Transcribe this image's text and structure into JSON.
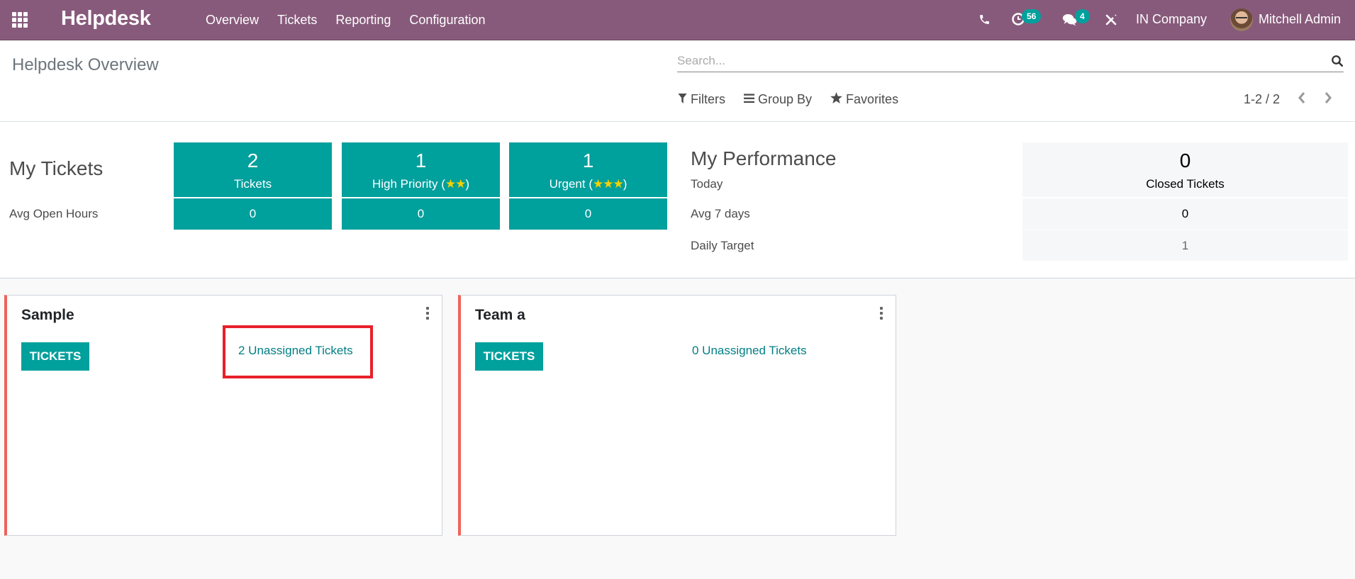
{
  "navbar": {
    "app_name": "Helpdesk",
    "menu": [
      "Overview",
      "Tickets",
      "Reporting",
      "Configuration"
    ],
    "activity_count": "56",
    "message_count": "4",
    "company": "IN Company",
    "user": "Mitchell Admin",
    "colors": {
      "brand": "#875a7b",
      "badge": "#00a09d"
    }
  },
  "control_panel": {
    "title": "Helpdesk Overview",
    "search_placeholder": "Search...",
    "filters_label": "Filters",
    "group_by_label": "Group By",
    "favorites_label": "Favorites",
    "pager": "1-2 / 2"
  },
  "dashboard": {
    "my_tickets": {
      "heading": "My Tickets",
      "avg_label": "Avg Open Hours",
      "tiles": [
        {
          "count": "2",
          "label": "Tickets",
          "stars": "",
          "avg": "0"
        },
        {
          "count": "1",
          "label": "High Priority (",
          "stars": "★★",
          "suffix": ")",
          "avg": "0"
        },
        {
          "count": "1",
          "label": "Urgent (",
          "stars": "★★★",
          "suffix": ")",
          "avg": "0"
        }
      ]
    },
    "my_performance": {
      "heading": "My Performance",
      "today_label": "Today",
      "avg7_label": "Avg 7 days",
      "target_label": "Daily Target",
      "closed_count": "0",
      "closed_label": "Closed Tickets",
      "avg7_value": "0",
      "target_value": "1"
    },
    "colors": {
      "tile": "#00a09d",
      "stars": "#f5d100"
    }
  },
  "teams": [
    {
      "name": "Sample",
      "button": "TICKETS",
      "unassigned": "2 Unassigned Tickets",
      "highlighted": true
    },
    {
      "name": "Team a",
      "button": "TICKETS",
      "unassigned": "0 Unassigned Tickets",
      "highlighted": false
    }
  ],
  "annotation": {
    "color": "#e8202a",
    "target": "2 Unassigned Tickets"
  }
}
